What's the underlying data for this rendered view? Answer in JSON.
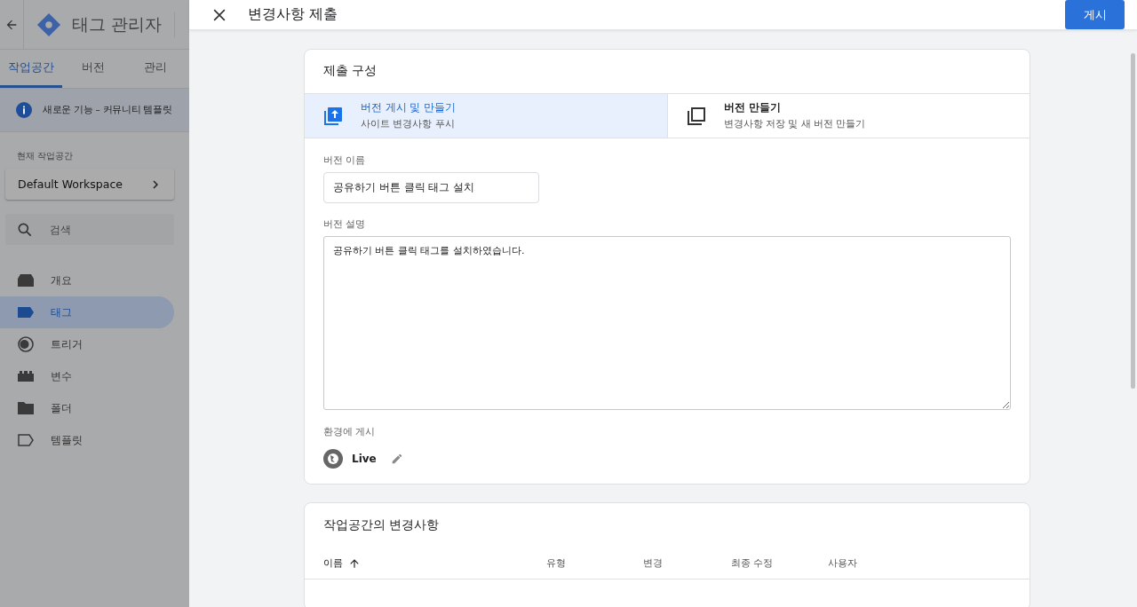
{
  "app": {
    "title": "태그 관리자"
  },
  "nav_tabs": [
    {
      "label": "작업공간",
      "selected": true
    },
    {
      "label": "버전",
      "selected": false
    },
    {
      "label": "관리",
      "selected": false
    }
  ],
  "banner": {
    "text": "새로운 기능 – 커뮤니티 템플릿"
  },
  "workspace": {
    "label": "현재 작업공간",
    "name": "Default Workspace"
  },
  "search": {
    "placeholder": "검색"
  },
  "sidebar_items": [
    {
      "label": "개요",
      "kind": "overview",
      "selected": false
    },
    {
      "label": "태그",
      "kind": "tag",
      "selected": true
    },
    {
      "label": "트리거",
      "kind": "trigger",
      "selected": false
    },
    {
      "label": "변수",
      "kind": "variable",
      "selected": false
    },
    {
      "label": "폴더",
      "kind": "folder",
      "selected": false
    },
    {
      "label": "템플릿",
      "kind": "template",
      "selected": false
    }
  ],
  "dialog": {
    "title": "변경사항 제출",
    "publish_button": "게시"
  },
  "config": {
    "title": "제출 구성",
    "options": [
      {
        "title": "버전 게시 및 만들기",
        "subtitle": "사이트 변경사항 푸시",
        "kind": "publish",
        "selected": true
      },
      {
        "title": "버전 만들기",
        "subtitle": "변경사항 저장 및 새 버전 만들기",
        "kind": "create",
        "selected": false
      }
    ],
    "version_name": {
      "label": "버전 이름",
      "value": "공유하기 버튼 클릭 태그 설치"
    },
    "version_description": {
      "label": "버전 설명",
      "value": "공유하기 버튼 클릭 태그를 설치하였습니다."
    },
    "environment": {
      "label": "환경에 게시",
      "name": "Live"
    }
  },
  "changes": {
    "title": "작업공간의 변경사항",
    "columns": [
      {
        "label": "이름",
        "sorted": true
      },
      {
        "label": "유형",
        "sorted": false
      },
      {
        "label": "변경",
        "sorted": false
      },
      {
        "label": "최종 수정",
        "sorted": false
      },
      {
        "label": "사용자",
        "sorted": false
      }
    ]
  }
}
